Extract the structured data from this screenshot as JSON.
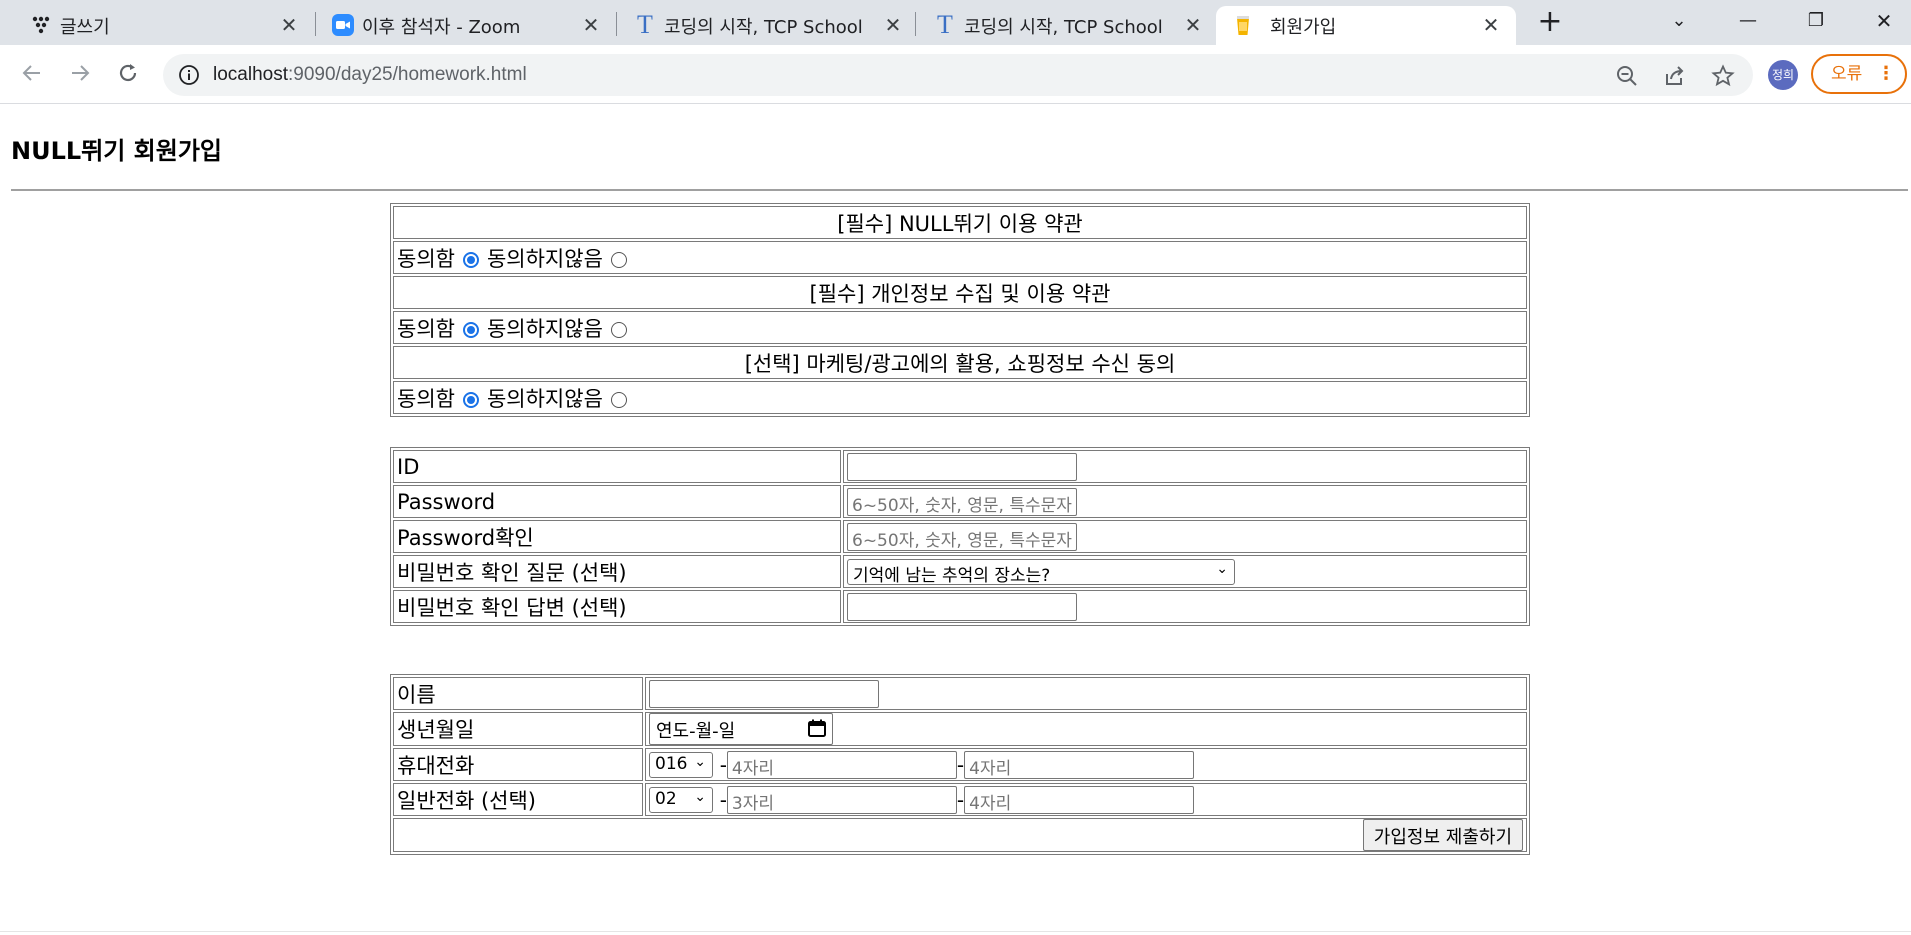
{
  "browser": {
    "tabs": [
      {
        "title": "글쓰기",
        "icon": "dots-logo-icon"
      },
      {
        "title": "이후 참석자 - Zoom",
        "icon": "zoom-icon"
      },
      {
        "title": "코딩의 시작, TCP School",
        "icon": "tcp-school-icon"
      },
      {
        "title": "코딩의 시작, TCP School",
        "icon": "tcp-school-icon"
      },
      {
        "title": "회원가입",
        "icon": "cup-icon",
        "active": true
      }
    ],
    "url_host": "localhost",
    "url_path": ":9090/day25/homework.html",
    "profile_initials": "정희",
    "error_label": "오류",
    "accent": "#e8710a"
  },
  "page": {
    "title": "NULL뛰기 회원가입"
  },
  "terms": [
    {
      "heading": "[필수] NULL뛰기 이용 약관",
      "agree": "동의함",
      "disagree": "동의하지않음",
      "selected": "agree"
    },
    {
      "heading": "[필수] 개인정보 수집 및 이용 약관",
      "agree": "동의함",
      "disagree": "동의하지않음",
      "selected": "agree"
    },
    {
      "heading": "[선택] 마케팅/광고에의 활용, 쇼핑정보 수신 동의",
      "agree": "동의함",
      "disagree": "동의하지않음",
      "selected": "agree"
    }
  ],
  "account": {
    "id_label": "ID",
    "id_value": "",
    "password_label": "Password",
    "password_placeholder": "6~50자, 숫자, 영문, 특수문자",
    "password_confirm_label": "Password확인",
    "password_confirm_placeholder": "6~50자, 숫자, 영문, 특수문자",
    "question_label": "비밀번호 확인 질문 (선택)",
    "question_selected": "기억에 남는 추억의 장소는?",
    "answer_label": "비밀번호 확인 답변 (선택)",
    "answer_value": ""
  },
  "personal": {
    "name_label": "이름",
    "name_value": "",
    "birth_label": "생년월일",
    "birth_placeholder": "연도-월-일",
    "mobile_label": "휴대전화",
    "mobile_prefix": "016",
    "mobile_mid_placeholder": "4자리",
    "mobile_last_placeholder": "4자리",
    "phone_label": "일반전화 (선택)",
    "phone_prefix": "02",
    "phone_mid_placeholder": "3자리",
    "phone_last_placeholder": "4자리",
    "dash": "-",
    "submit_label": "가입정보 제출하기"
  }
}
